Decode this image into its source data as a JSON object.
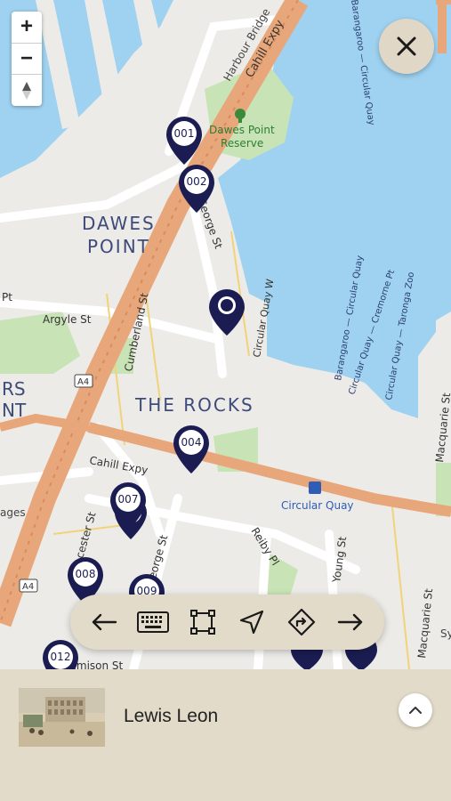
{
  "map": {
    "zoom_in_label": "+",
    "zoom_out_label": "−",
    "labels": {
      "harbour_bridge": "Harbour Bridge",
      "cahill_expy_top": "Cahill Expy",
      "dawes_point_reserve_1": "Dawes Point",
      "dawes_point_reserve_2": "Reserve",
      "dawes": "DAWES",
      "point": "POINT",
      "george_st_top": "George St",
      "george_st_bottom": "George St",
      "cumberland_st": "Cumberland St",
      "argyle_st": "Argyle St",
      "circular_quay_w": "Circular Quay W",
      "the_rocks": "THE ROCKS",
      "cahill_expy_mid": "Cahill Expy",
      "circular_quay": "Circular Quay",
      "ferry_1": "Barangaroo — Circular Quay",
      "ferry_2": "Circular Quay — Cremorne Pt",
      "ferry_3": "Circular Quay — Taronga Zoo",
      "ferry_top": "Barangaroo — Circular Quay",
      "macquarie_st": "Macquarie St",
      "macquarie_st_2": "Macquarie St",
      "reiby_pl": "Reiby Pl",
      "young_st": "Young St",
      "jamison_st": "Jamison St",
      "cester_st": "cester St",
      "a4_top": "A4",
      "a4_bottom": "A4",
      "pt_left": "Pt",
      "rs_left": "RS",
      "nt_left": "NT",
      "ages_left": "ages",
      "sy_right": "Sy"
    }
  },
  "pins": [
    {
      "label": "001"
    },
    {
      "label": "002"
    },
    {
      "label": "004"
    },
    {
      "label": "007"
    },
    {
      "label": "008"
    },
    {
      "label": "009"
    },
    {
      "label": "012"
    }
  ],
  "toolbar": {
    "items": [
      "back-arrow-icon",
      "keyboard-icon",
      "select-frame-icon",
      "navigation-icon",
      "directions-icon",
      "forward-arrow-icon"
    ]
  },
  "sheet": {
    "title": "Lewis Leon"
  },
  "colors": {
    "water": "#9ed2f0",
    "land": "#ecebe7",
    "park": "#c8e4b6",
    "motorway": "#e8a77a",
    "pin": "#1b1d52",
    "panel": "#e3dbc9"
  }
}
